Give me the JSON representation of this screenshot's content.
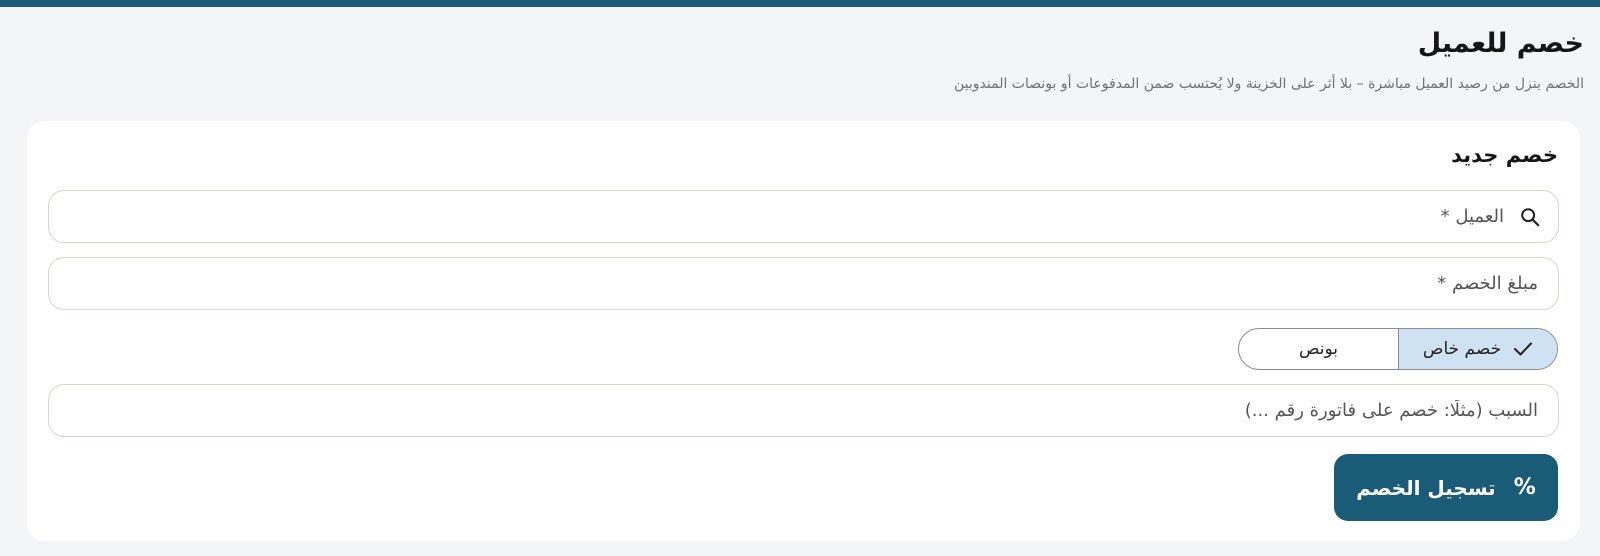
{
  "colors": {
    "accent": "#1a5b78",
    "background": "#f4f5f7",
    "card": "#ffffff",
    "field_border": "#ddd6c6",
    "toggle_selected": "#cfe2f3"
  },
  "header": {
    "title": "خصم للعميل",
    "subtitle": "الخصم ينزل من رصيد العميل مباشرة – بلا أثر على الخزينة ولا يُحتسب ضمن المدفوعات أو بونصات المندوبين"
  },
  "form": {
    "title": "خصم جديد",
    "customer": {
      "placeholder": "العميل *",
      "value": "",
      "icon": "search-icon"
    },
    "amount": {
      "placeholder": "مبلغ الخصم *",
      "value": ""
    },
    "type_toggle": {
      "options": [
        {
          "label": "خصم خاص",
          "selected": true,
          "icon": "check-icon"
        },
        {
          "label": "بونص",
          "selected": false
        }
      ]
    },
    "reason": {
      "placeholder": "السبب (مثلًا: خصم على فاتورة رقم ...)",
      "value": ""
    },
    "submit": {
      "label": "تسجيل الخصم",
      "icon": "percent-icon",
      "icon_glyph": "%"
    }
  }
}
